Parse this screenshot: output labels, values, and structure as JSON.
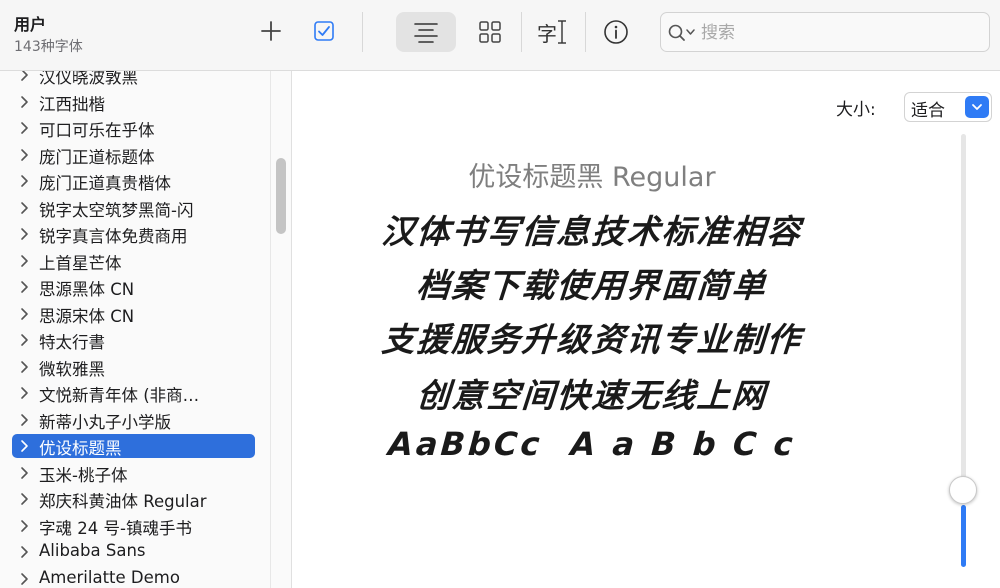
{
  "header": {
    "title": "用户",
    "subtitle": "143种字体"
  },
  "toolbar": {
    "icons": [
      "plus-icon",
      "checkbox-icon",
      "align-center-icon",
      "grid-icon",
      "text-cursor-icon",
      "info-icon"
    ],
    "type_icon_glyph": "字",
    "search_placeholder": "搜索",
    "accent_color": "#2f7bf5"
  },
  "sidebar": {
    "items": [
      {
        "label": "汉仪晓波敦黑",
        "selected": false
      },
      {
        "label": "江西拙楷",
        "selected": false
      },
      {
        "label": "可口可乐在乎体",
        "selected": false
      },
      {
        "label": "庞门正道标题体",
        "selected": false
      },
      {
        "label": "庞门正道真贵楷体",
        "selected": false
      },
      {
        "label": "锐字太空筑梦黑简-闪",
        "selected": false
      },
      {
        "label": "锐字真言体免费商用",
        "selected": false
      },
      {
        "label": "上首星芒体",
        "selected": false
      },
      {
        "label": "思源黑体 CN",
        "selected": false
      },
      {
        "label": "思源宋体 CN",
        "selected": false
      },
      {
        "label": "特太行書",
        "selected": false
      },
      {
        "label": "微软雅黑",
        "selected": false
      },
      {
        "label": "文悦新青年体 (非商…",
        "selected": false
      },
      {
        "label": "新蒂小丸子小学版",
        "selected": false
      },
      {
        "label": "优设标题黑",
        "selected": true
      },
      {
        "label": "玉米-桃子体",
        "selected": false
      },
      {
        "label": "郑庆科黄油体 Regular",
        "selected": false
      },
      {
        "label": "字魂 24 号-镇魂手书",
        "selected": false
      },
      {
        "label": "Alibaba Sans",
        "selected": false
      },
      {
        "label": "Amerilatte Demo",
        "selected": false
      }
    ],
    "selection_color": "#2e6fdc"
  },
  "preview": {
    "size_label": "大小:",
    "size_value": "适合",
    "font_name": "优设标题黑 Regular",
    "sample_lines": [
      "汉体书写信息技术标准相容",
      "档案下载使用界面简单",
      "支援服务升级资讯专业制作",
      "创意空间快速无线上网",
      "AaBbCc  A a B b C c"
    ],
    "size_slider_fraction": 0.17
  }
}
